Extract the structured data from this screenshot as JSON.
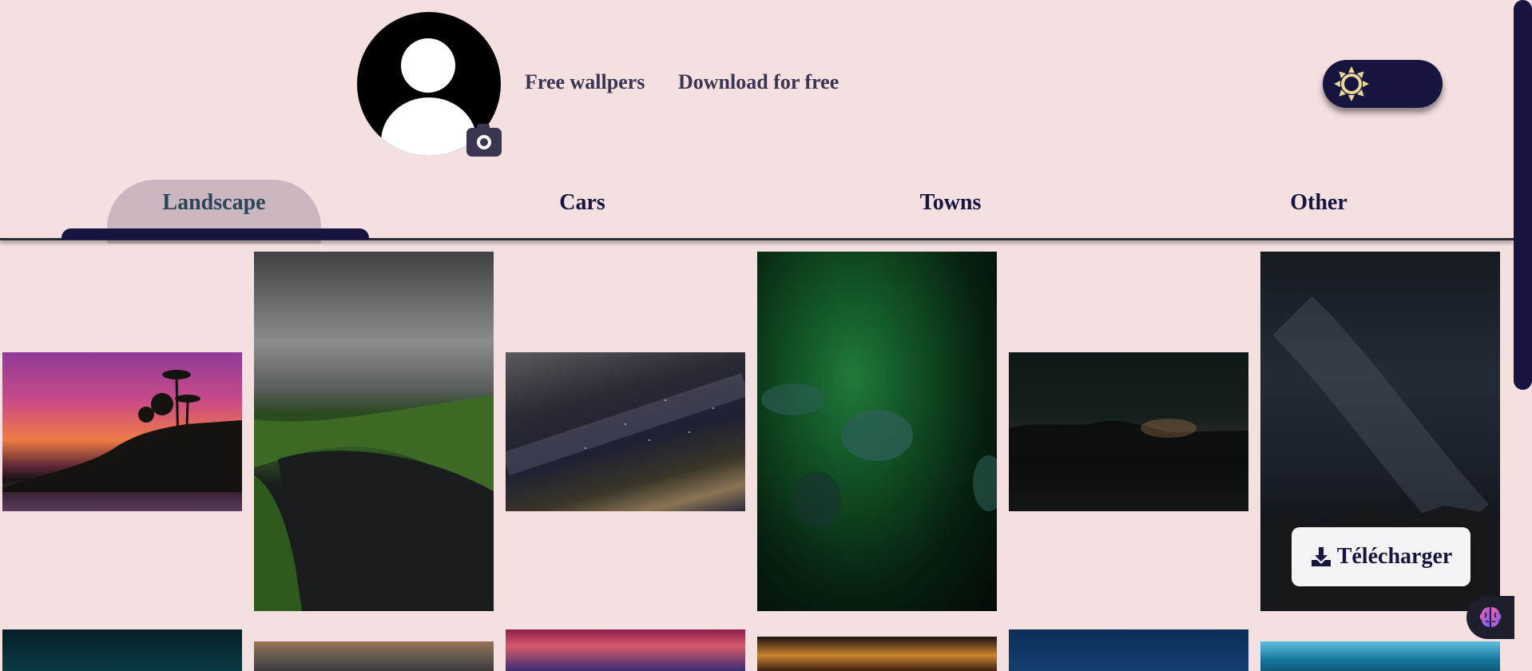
{
  "header": {
    "avatar_icon": "user-avatar-icon",
    "camera_icon": "camera-icon",
    "links": [
      "Free wallpers",
      "Download for free"
    ],
    "theme_toggle_icon": "sun-icon"
  },
  "nav": {
    "tabs": [
      "Landscape",
      "Cars",
      "Towns",
      "Other"
    ],
    "active_tab": "Landscape"
  },
  "gallery": {
    "download_label": "Télécharger",
    "download_icon": "download-icon"
  },
  "fab_icon": "brain-icon",
  "colors": {
    "background": "#f4dfe1",
    "accent": "#17153f",
    "active_tab_bg": "#cbb7bf"
  }
}
